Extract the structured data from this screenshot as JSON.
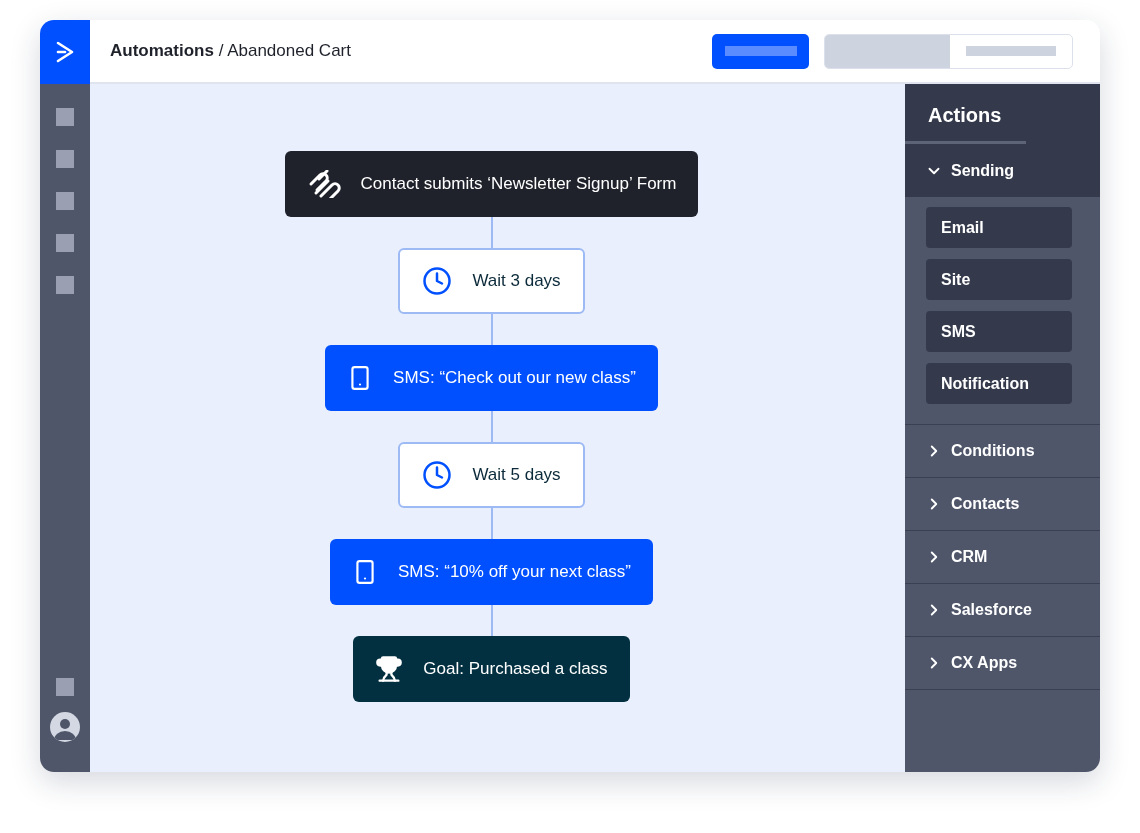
{
  "breadcrumb": {
    "section": "Automations",
    "separator": "/",
    "page": "Abandoned Cart"
  },
  "flow": [
    {
      "kind": "trigger",
      "label": "Contact submits ‘Newsletter Signup’ Form"
    },
    {
      "kind": "wait",
      "label": "Wait 3 days"
    },
    {
      "kind": "sms",
      "label": "SMS: “Check out our new class”"
    },
    {
      "kind": "wait",
      "label": "Wait 5 days"
    },
    {
      "kind": "sms",
      "label": "SMS: “10% off your next class”"
    },
    {
      "kind": "goal",
      "label": "Goal: Purchased a class"
    }
  ],
  "panel": {
    "title": "Actions",
    "sections": [
      {
        "label": "Sending",
        "expanded": true,
        "items": [
          "Email",
          "Site",
          "SMS",
          "Notification"
        ]
      },
      {
        "label": "Conditions",
        "expanded": false
      },
      {
        "label": "Contacts",
        "expanded": false
      },
      {
        "label": "CRM",
        "expanded": false
      },
      {
        "label": "Salesforce",
        "expanded": false
      },
      {
        "label": "CX Apps",
        "expanded": false
      }
    ]
  }
}
